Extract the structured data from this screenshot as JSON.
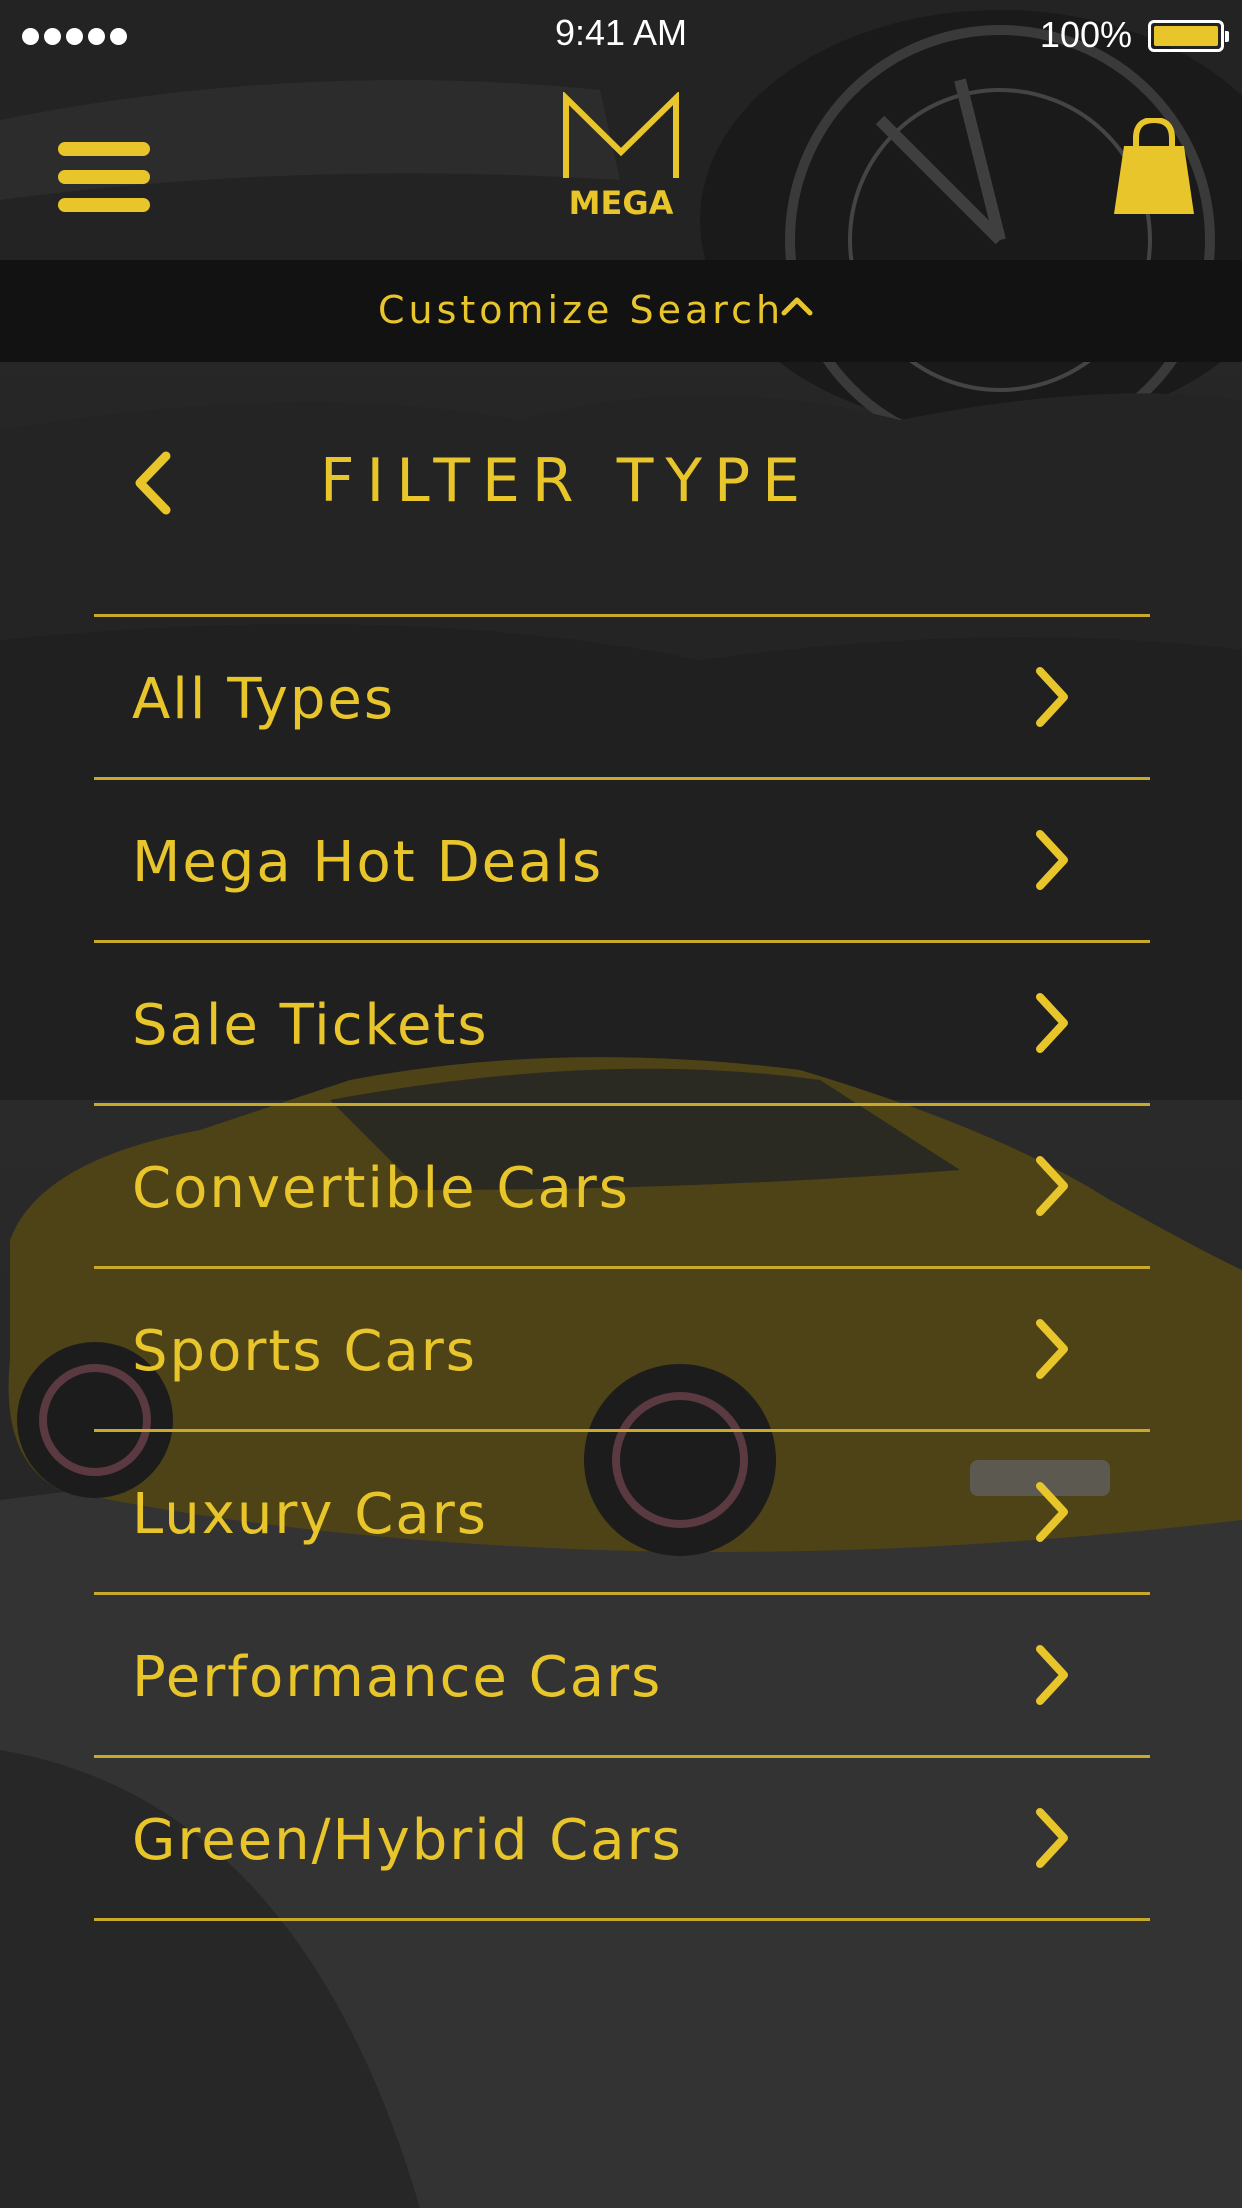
{
  "status_bar": {
    "time": "9:41 AM",
    "battery_percent": "100%",
    "signal_dots": 5,
    "battery_level": 1.0
  },
  "header": {
    "logo_letter": "M",
    "logo_word": "MEGA",
    "menu_icon": "hamburger-menu-icon",
    "bag_icon": "shopping-bag-icon"
  },
  "customize_search": {
    "label": "Customize Search",
    "icon": "chevron-up-icon"
  },
  "filter": {
    "title": "FILTER TYPE",
    "back_icon": "chevron-left-icon",
    "items": [
      {
        "label": "All Types"
      },
      {
        "label": "Mega Hot Deals"
      },
      {
        "label": "Sale Tickets"
      },
      {
        "label": "Convertible Cars"
      },
      {
        "label": "Sports Cars"
      },
      {
        "label": "Luxury Cars"
      },
      {
        "label": "Performance Cars"
      },
      {
        "label": "Green/Hybrid Cars"
      }
    ]
  },
  "colors": {
    "accent": "#e8c52a",
    "divider": "#c9a92a",
    "bar_background": "#121212",
    "text_white": "#ffffff"
  }
}
